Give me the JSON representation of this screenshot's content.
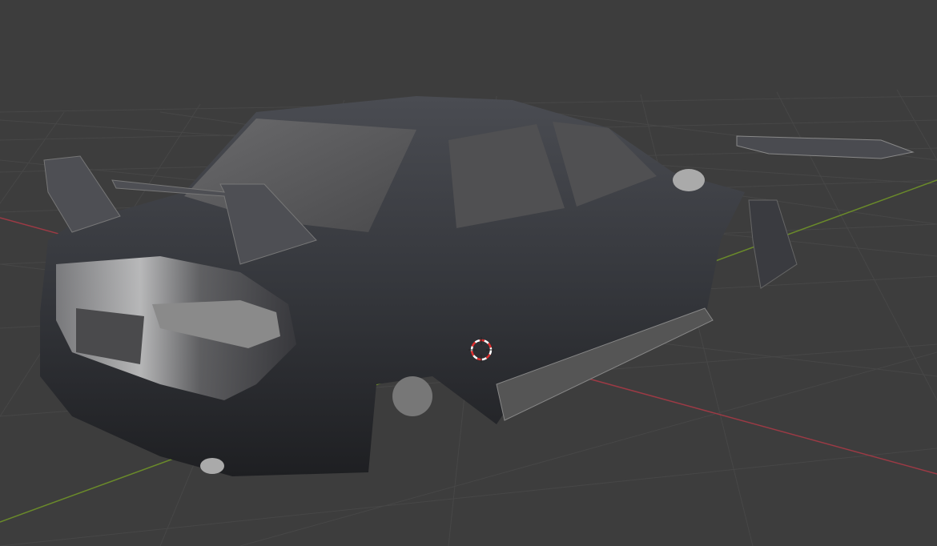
{
  "viewport": {
    "background": "#3d3d3d",
    "grid_color": "#4a4a4a",
    "x_axis_color": "#9c3a45",
    "y_axis_color": "#6a8a2a",
    "cursor_colors": [
      "#e03030",
      "#ffffff"
    ]
  },
  "model": {
    "body_color": "#3a3c42",
    "glass_color": "#5a5a5c"
  }
}
